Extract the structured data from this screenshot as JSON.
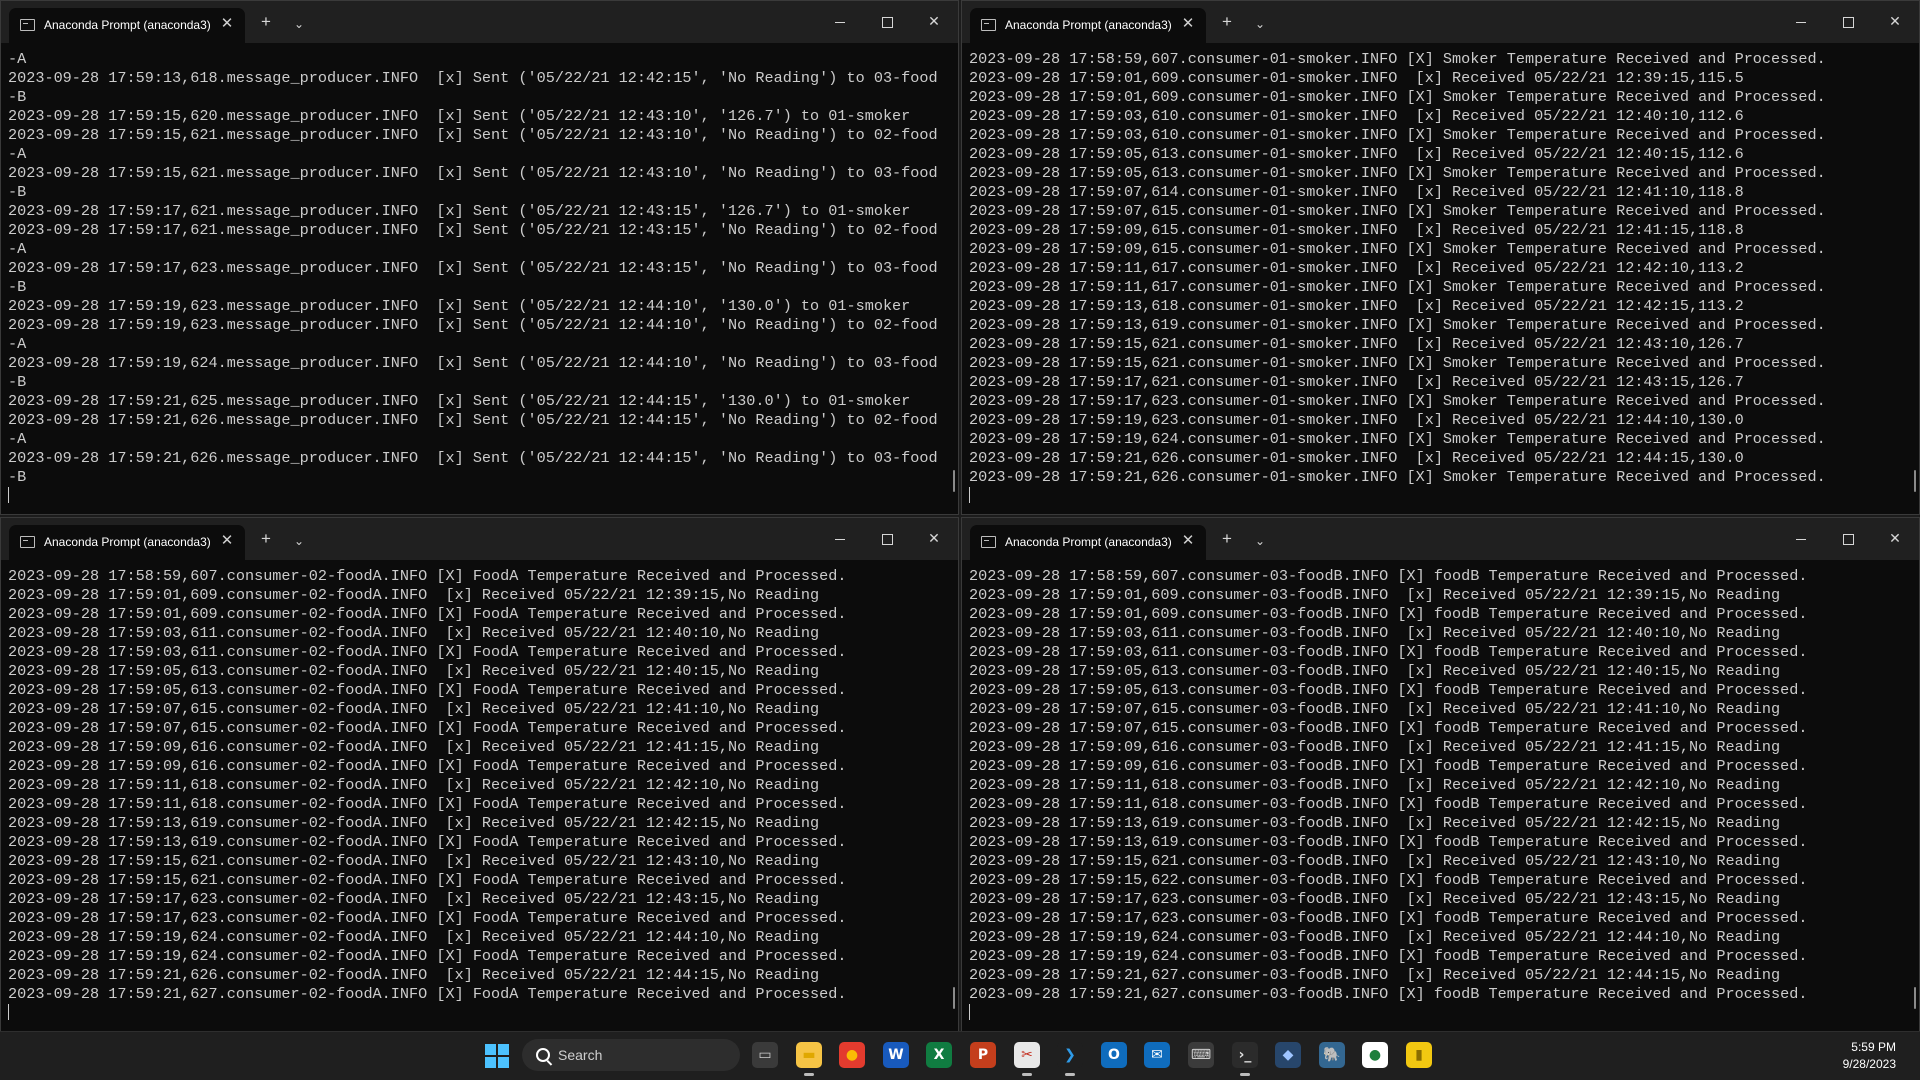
{
  "windows": {
    "top_left": {
      "tab_title": "Anaconda Prompt (anaconda3)",
      "lines": [
        "-A",
        "2023-09-28 17:59:13,618.message_producer.INFO  [x] Sent ('05/22/21 12:42:15', 'No Reading') to 03-food",
        "-B",
        "2023-09-28 17:59:15,620.message_producer.INFO  [x] Sent ('05/22/21 12:43:10', '126.7') to 01-smoker",
        "2023-09-28 17:59:15,621.message_producer.INFO  [x] Sent ('05/22/21 12:43:10', 'No Reading') to 02-food",
        "-A",
        "2023-09-28 17:59:15,621.message_producer.INFO  [x] Sent ('05/22/21 12:43:10', 'No Reading') to 03-food",
        "-B",
        "2023-09-28 17:59:17,621.message_producer.INFO  [x] Sent ('05/22/21 12:43:15', '126.7') to 01-smoker",
        "2023-09-28 17:59:17,621.message_producer.INFO  [x] Sent ('05/22/21 12:43:15', 'No Reading') to 02-food",
        "-A",
        "2023-09-28 17:59:17,623.message_producer.INFO  [x] Sent ('05/22/21 12:43:15', 'No Reading') to 03-food",
        "-B",
        "2023-09-28 17:59:19,623.message_producer.INFO  [x] Sent ('05/22/21 12:44:10', '130.0') to 01-smoker",
        "2023-09-28 17:59:19,623.message_producer.INFO  [x] Sent ('05/22/21 12:44:10', 'No Reading') to 02-food",
        "-A",
        "2023-09-28 17:59:19,624.message_producer.INFO  [x] Sent ('05/22/21 12:44:10', 'No Reading') to 03-food",
        "-B",
        "2023-09-28 17:59:21,625.message_producer.INFO  [x] Sent ('05/22/21 12:44:15', '130.0') to 01-smoker",
        "2023-09-28 17:59:21,626.message_producer.INFO  [x] Sent ('05/22/21 12:44:15', 'No Reading') to 02-food",
        "-A",
        "2023-09-28 17:59:21,626.message_producer.INFO  [x] Sent ('05/22/21 12:44:15', 'No Reading') to 03-food",
        "-B"
      ]
    },
    "top_right": {
      "tab_title": "Anaconda Prompt (anaconda3)",
      "lines": [
        "2023-09-28 17:58:59,607.consumer-01-smoker.INFO [X] Smoker Temperature Received and Processed.",
        "2023-09-28 17:59:01,609.consumer-01-smoker.INFO  [x] Received 05/22/21 12:39:15,115.5",
        "2023-09-28 17:59:01,609.consumer-01-smoker.INFO [X] Smoker Temperature Received and Processed.",
        "2023-09-28 17:59:03,610.consumer-01-smoker.INFO  [x] Received 05/22/21 12:40:10,112.6",
        "2023-09-28 17:59:03,610.consumer-01-smoker.INFO [X] Smoker Temperature Received and Processed.",
        "2023-09-28 17:59:05,613.consumer-01-smoker.INFO  [x] Received 05/22/21 12:40:15,112.6",
        "2023-09-28 17:59:05,613.consumer-01-smoker.INFO [X] Smoker Temperature Received and Processed.",
        "2023-09-28 17:59:07,614.consumer-01-smoker.INFO  [x] Received 05/22/21 12:41:10,118.8",
        "2023-09-28 17:59:07,615.consumer-01-smoker.INFO [X] Smoker Temperature Received and Processed.",
        "2023-09-28 17:59:09,615.consumer-01-smoker.INFO  [x] Received 05/22/21 12:41:15,118.8",
        "2023-09-28 17:59:09,615.consumer-01-smoker.INFO [X] Smoker Temperature Received and Processed.",
        "2023-09-28 17:59:11,617.consumer-01-smoker.INFO  [x] Received 05/22/21 12:42:10,113.2",
        "2023-09-28 17:59:11,617.consumer-01-smoker.INFO [X] Smoker Temperature Received and Processed.",
        "2023-09-28 17:59:13,618.consumer-01-smoker.INFO  [x] Received 05/22/21 12:42:15,113.2",
        "2023-09-28 17:59:13,619.consumer-01-smoker.INFO [X] Smoker Temperature Received and Processed.",
        "2023-09-28 17:59:15,621.consumer-01-smoker.INFO  [x] Received 05/22/21 12:43:10,126.7",
        "2023-09-28 17:59:15,621.consumer-01-smoker.INFO [X] Smoker Temperature Received and Processed.",
        "2023-09-28 17:59:17,621.consumer-01-smoker.INFO  [x] Received 05/22/21 12:43:15,126.7",
        "2023-09-28 17:59:17,623.consumer-01-smoker.INFO [X] Smoker Temperature Received and Processed.",
        "2023-09-28 17:59:19,623.consumer-01-smoker.INFO  [x] Received 05/22/21 12:44:10,130.0",
        "2023-09-28 17:59:19,624.consumer-01-smoker.INFO [X] Smoker Temperature Received and Processed.",
        "2023-09-28 17:59:21,626.consumer-01-smoker.INFO  [x] Received 05/22/21 12:44:15,130.0",
        "2023-09-28 17:59:21,626.consumer-01-smoker.INFO [X] Smoker Temperature Received and Processed."
      ]
    },
    "bottom_left": {
      "tab_title": "Anaconda Prompt (anaconda3)",
      "lines": [
        "2023-09-28 17:58:59,607.consumer-02-foodA.INFO [X] FoodA Temperature Received and Processed.",
        "2023-09-28 17:59:01,609.consumer-02-foodA.INFO  [x] Received 05/22/21 12:39:15,No Reading",
        "2023-09-28 17:59:01,609.consumer-02-foodA.INFO [X] FoodA Temperature Received and Processed.",
        "2023-09-28 17:59:03,611.consumer-02-foodA.INFO  [x] Received 05/22/21 12:40:10,No Reading",
        "2023-09-28 17:59:03,611.consumer-02-foodA.INFO [X] FoodA Temperature Received and Processed.",
        "2023-09-28 17:59:05,613.consumer-02-foodA.INFO  [x] Received 05/22/21 12:40:15,No Reading",
        "2023-09-28 17:59:05,613.consumer-02-foodA.INFO [X] FoodA Temperature Received and Processed.",
        "2023-09-28 17:59:07,615.consumer-02-foodA.INFO  [x] Received 05/22/21 12:41:10,No Reading",
        "2023-09-28 17:59:07,615.consumer-02-foodA.INFO [X] FoodA Temperature Received and Processed.",
        "2023-09-28 17:59:09,616.consumer-02-foodA.INFO  [x] Received 05/22/21 12:41:15,No Reading",
        "2023-09-28 17:59:09,616.consumer-02-foodA.INFO [X] FoodA Temperature Received and Processed.",
        "2023-09-28 17:59:11,618.consumer-02-foodA.INFO  [x] Received 05/22/21 12:42:10,No Reading",
        "2023-09-28 17:59:11,618.consumer-02-foodA.INFO [X] FoodA Temperature Received and Processed.",
        "2023-09-28 17:59:13,619.consumer-02-foodA.INFO  [x] Received 05/22/21 12:42:15,No Reading",
        "2023-09-28 17:59:13,619.consumer-02-foodA.INFO [X] FoodA Temperature Received and Processed.",
        "2023-09-28 17:59:15,621.consumer-02-foodA.INFO  [x] Received 05/22/21 12:43:10,No Reading",
        "2023-09-28 17:59:15,621.consumer-02-foodA.INFO [X] FoodA Temperature Received and Processed.",
        "2023-09-28 17:59:17,623.consumer-02-foodA.INFO  [x] Received 05/22/21 12:43:15,No Reading",
        "2023-09-28 17:59:17,623.consumer-02-foodA.INFO [X] FoodA Temperature Received and Processed.",
        "2023-09-28 17:59:19,624.consumer-02-foodA.INFO  [x] Received 05/22/21 12:44:10,No Reading",
        "2023-09-28 17:59:19,624.consumer-02-foodA.INFO [X] FoodA Temperature Received and Processed.",
        "2023-09-28 17:59:21,626.consumer-02-foodA.INFO  [x] Received 05/22/21 12:44:15,No Reading",
        "2023-09-28 17:59:21,627.consumer-02-foodA.INFO [X] FoodA Temperature Received and Processed."
      ]
    },
    "bottom_right": {
      "tab_title": "Anaconda Prompt (anaconda3)",
      "lines": [
        "2023-09-28 17:58:59,607.consumer-03-foodB.INFO [X] foodB Temperature Received and Processed.",
        "2023-09-28 17:59:01,609.consumer-03-foodB.INFO  [x] Received 05/22/21 12:39:15,No Reading",
        "2023-09-28 17:59:01,609.consumer-03-foodB.INFO [X] foodB Temperature Received and Processed.",
        "2023-09-28 17:59:03,611.consumer-03-foodB.INFO  [x] Received 05/22/21 12:40:10,No Reading",
        "2023-09-28 17:59:03,611.consumer-03-foodB.INFO [X] foodB Temperature Received and Processed.",
        "2023-09-28 17:59:05,613.consumer-03-foodB.INFO  [x] Received 05/22/21 12:40:15,No Reading",
        "2023-09-28 17:59:05,613.consumer-03-foodB.INFO [X] foodB Temperature Received and Processed.",
        "2023-09-28 17:59:07,615.consumer-03-foodB.INFO  [x] Received 05/22/21 12:41:10,No Reading",
        "2023-09-28 17:59:07,615.consumer-03-foodB.INFO [X] foodB Temperature Received and Processed.",
        "2023-09-28 17:59:09,616.consumer-03-foodB.INFO  [x] Received 05/22/21 12:41:15,No Reading",
        "2023-09-28 17:59:09,616.consumer-03-foodB.INFO [X] foodB Temperature Received and Processed.",
        "2023-09-28 17:59:11,618.consumer-03-foodB.INFO  [x] Received 05/22/21 12:42:10,No Reading",
        "2023-09-28 17:59:11,618.consumer-03-foodB.INFO [X] foodB Temperature Received and Processed.",
        "2023-09-28 17:59:13,619.consumer-03-foodB.INFO  [x] Received 05/22/21 12:42:15,No Reading",
        "2023-09-28 17:59:13,619.consumer-03-foodB.INFO [X] foodB Temperature Received and Processed.",
        "2023-09-28 17:59:15,621.consumer-03-foodB.INFO  [x] Received 05/22/21 12:43:10,No Reading",
        "2023-09-28 17:59:15,622.consumer-03-foodB.INFO [X] foodB Temperature Received and Processed.",
        "2023-09-28 17:59:17,623.consumer-03-foodB.INFO  [x] Received 05/22/21 12:43:15,No Reading",
        "2023-09-28 17:59:17,623.consumer-03-foodB.INFO [X] foodB Temperature Received and Processed.",
        "2023-09-28 17:59:19,624.consumer-03-foodB.INFO  [x] Received 05/22/21 12:44:10,No Reading",
        "2023-09-28 17:59:19,624.consumer-03-foodB.INFO [X] foodB Temperature Received and Processed.",
        "2023-09-28 17:59:21,627.consumer-03-foodB.INFO  [x] Received 05/22/21 12:44:15,No Reading",
        "2023-09-28 17:59:21,627.consumer-03-foodB.INFO [X] foodB Temperature Received and Processed."
      ]
    }
  },
  "taskbar": {
    "search_label": "Search",
    "apps": [
      "task-view-icon",
      "file-explorer-icon",
      "chrome-icon",
      "word-icon",
      "excel-icon",
      "powerpoint-icon",
      "snipping-tool-icon",
      "vscode-icon",
      "outlook-icon",
      "mail-icon",
      "keyboard-icon",
      "terminal-icon",
      "network-icon",
      "postgres-icon",
      "app-icon",
      "power-bi-icon"
    ],
    "clock_time": "5:59 PM",
    "clock_date": "9/28/2023"
  },
  "colors": {
    "terminal_bg": "#0c0c0c",
    "terminal_fg": "#cccccc",
    "titlebar_bg": "#202020",
    "taskbar_bg": "#1f1f1f",
    "accent": "#4cc2ff"
  }
}
